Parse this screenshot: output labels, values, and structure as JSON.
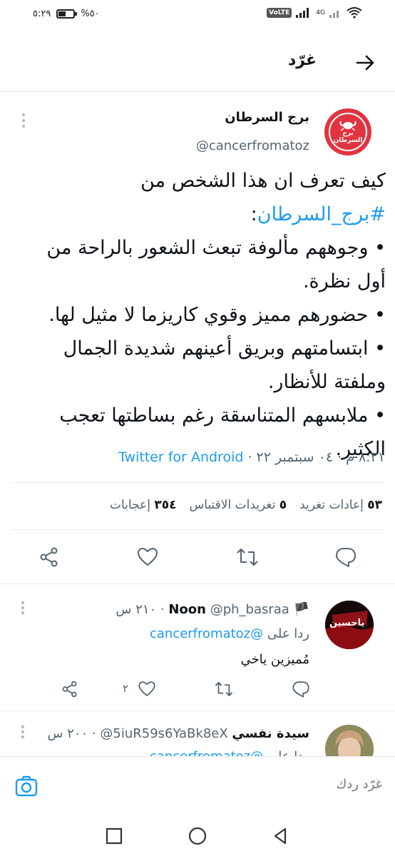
{
  "status_bar": {
    "time": "٥:٢٩",
    "battery_text": "%٥٠",
    "battery_level": 0.5,
    "network": "4G",
    "volte": "VoLTE"
  },
  "header": {
    "title": "غرّد"
  },
  "tweet": {
    "display_name": "برج السرطان",
    "username": "@cancerfromatoz",
    "avatar_line1": "برج",
    "avatar_line2": "السرطان",
    "text_lines": [
      "كيف تعرف ان هذا الشخص من",
      "• وجوههم مألوفة تبعث الشعور بالراحة من",
      "أول نظرة.",
      "• حضورهم مميز وقوي كاريزما لا مثيل لها.",
      "• ابتسامتهم وبريق أعينهم شديدة الجمال",
      "وملفتة للأنظار.",
      "• ملابسهم المتناسقة رغم بساطتها تعجب",
      "الكثير."
    ],
    "hashtag": "#برج_السرطان",
    "hashtag_suffix": ":",
    "meta_time": "٨:٢١ م · ٠٤ سبتمبر ٢٢ · ",
    "meta_source": "Twitter for Android",
    "stats": {
      "retweets_count": "٥٣",
      "retweets_label": "إعادات تغريد",
      "quotes_count": "٥",
      "quotes_label": "تغريدات الاقتباس",
      "likes_count": "٣٥٤",
      "likes_label": "إعجابات"
    }
  },
  "replies": [
    {
      "name": "Noon",
      "flag": "🏴",
      "handle": "@ph_basraa",
      "time": "٢١٠ س",
      "replying_prefix": "ردا على",
      "replying_to": "@cancerfromatoz",
      "text": "مُميزين ياخي",
      "likes": "٢",
      "avatar_text": "ياحسين"
    },
    {
      "name": "سيدة نفسي",
      "handle": "@5iuR59s6YaBk8eX",
      "time": "٢٠٠ س",
      "replying_prefix": "ردا على",
      "replying_to": "@cancerfromatoz"
    }
  ],
  "composer": {
    "placeholder": "غرّد ردك"
  },
  "colors": {
    "accent": "#1d9bf0",
    "avatar_bg": "#e23440",
    "secondary_text": "#536471"
  }
}
